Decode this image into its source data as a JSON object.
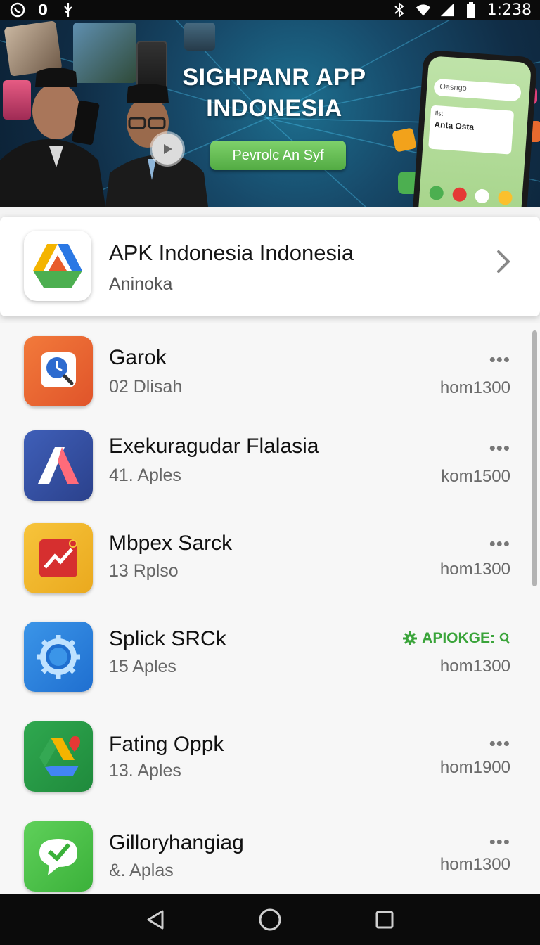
{
  "status_bar": {
    "left_icons": [
      "whatsapp-icon",
      "notification-zero",
      "usb-icon"
    ],
    "left_text_zero": "0",
    "right_icons": [
      "bluetooth-icon",
      "wifi-icon",
      "signal-icon",
      "battery-icon"
    ],
    "time": "1:238"
  },
  "banner": {
    "title_line1": "SIGHPANR APP",
    "title_line2": "INDONESIA",
    "cta_label": "Pevrolc An Syf",
    "phone_search_placeholder": "Oasngo",
    "phone_card_small": "Ilst",
    "phone_card_title": "Anta Osta"
  },
  "featured": {
    "title": "APK Indonesia Indonesia",
    "subtitle": "Aninoka"
  },
  "apps": [
    {
      "name": "Garok",
      "sub": "02 Dlisah",
      "meta": "hom1300",
      "icon": "clock-search-icon",
      "dots": "•••"
    },
    {
      "name": "Exekuragudar Flalasia",
      "sub": "41. Aples",
      "meta": "kom1500",
      "icon": "arrow-a-icon",
      "dots": "•••"
    },
    {
      "name": "Mbpex Sarck",
      "sub": "13 Rplso",
      "meta": "hom1300",
      "icon": "chart-trend-icon",
      "dots": "•••"
    },
    {
      "name": "Splick SRCk",
      "sub": "15 Aples",
      "meta": "hom1300",
      "icon": "gear-circle-icon",
      "badge": "APIOKGE:"
    },
    {
      "name": "Fating Oppk",
      "sub": "13. Aples",
      "meta": "hom1900",
      "icon": "drive-heart-icon",
      "dots": "•••"
    },
    {
      "name": "Gilloryhangiag",
      "sub": "&. Aplas",
      "meta": "hom1300",
      "icon": "chat-check-icon",
      "dots": "•••"
    }
  ],
  "nav": [
    "back-icon",
    "home-icon",
    "recents-icon"
  ],
  "colors": {
    "accent_green": "#3aa43a",
    "banner_dark": "#102d46",
    "cta_green": "#5cb84a"
  }
}
